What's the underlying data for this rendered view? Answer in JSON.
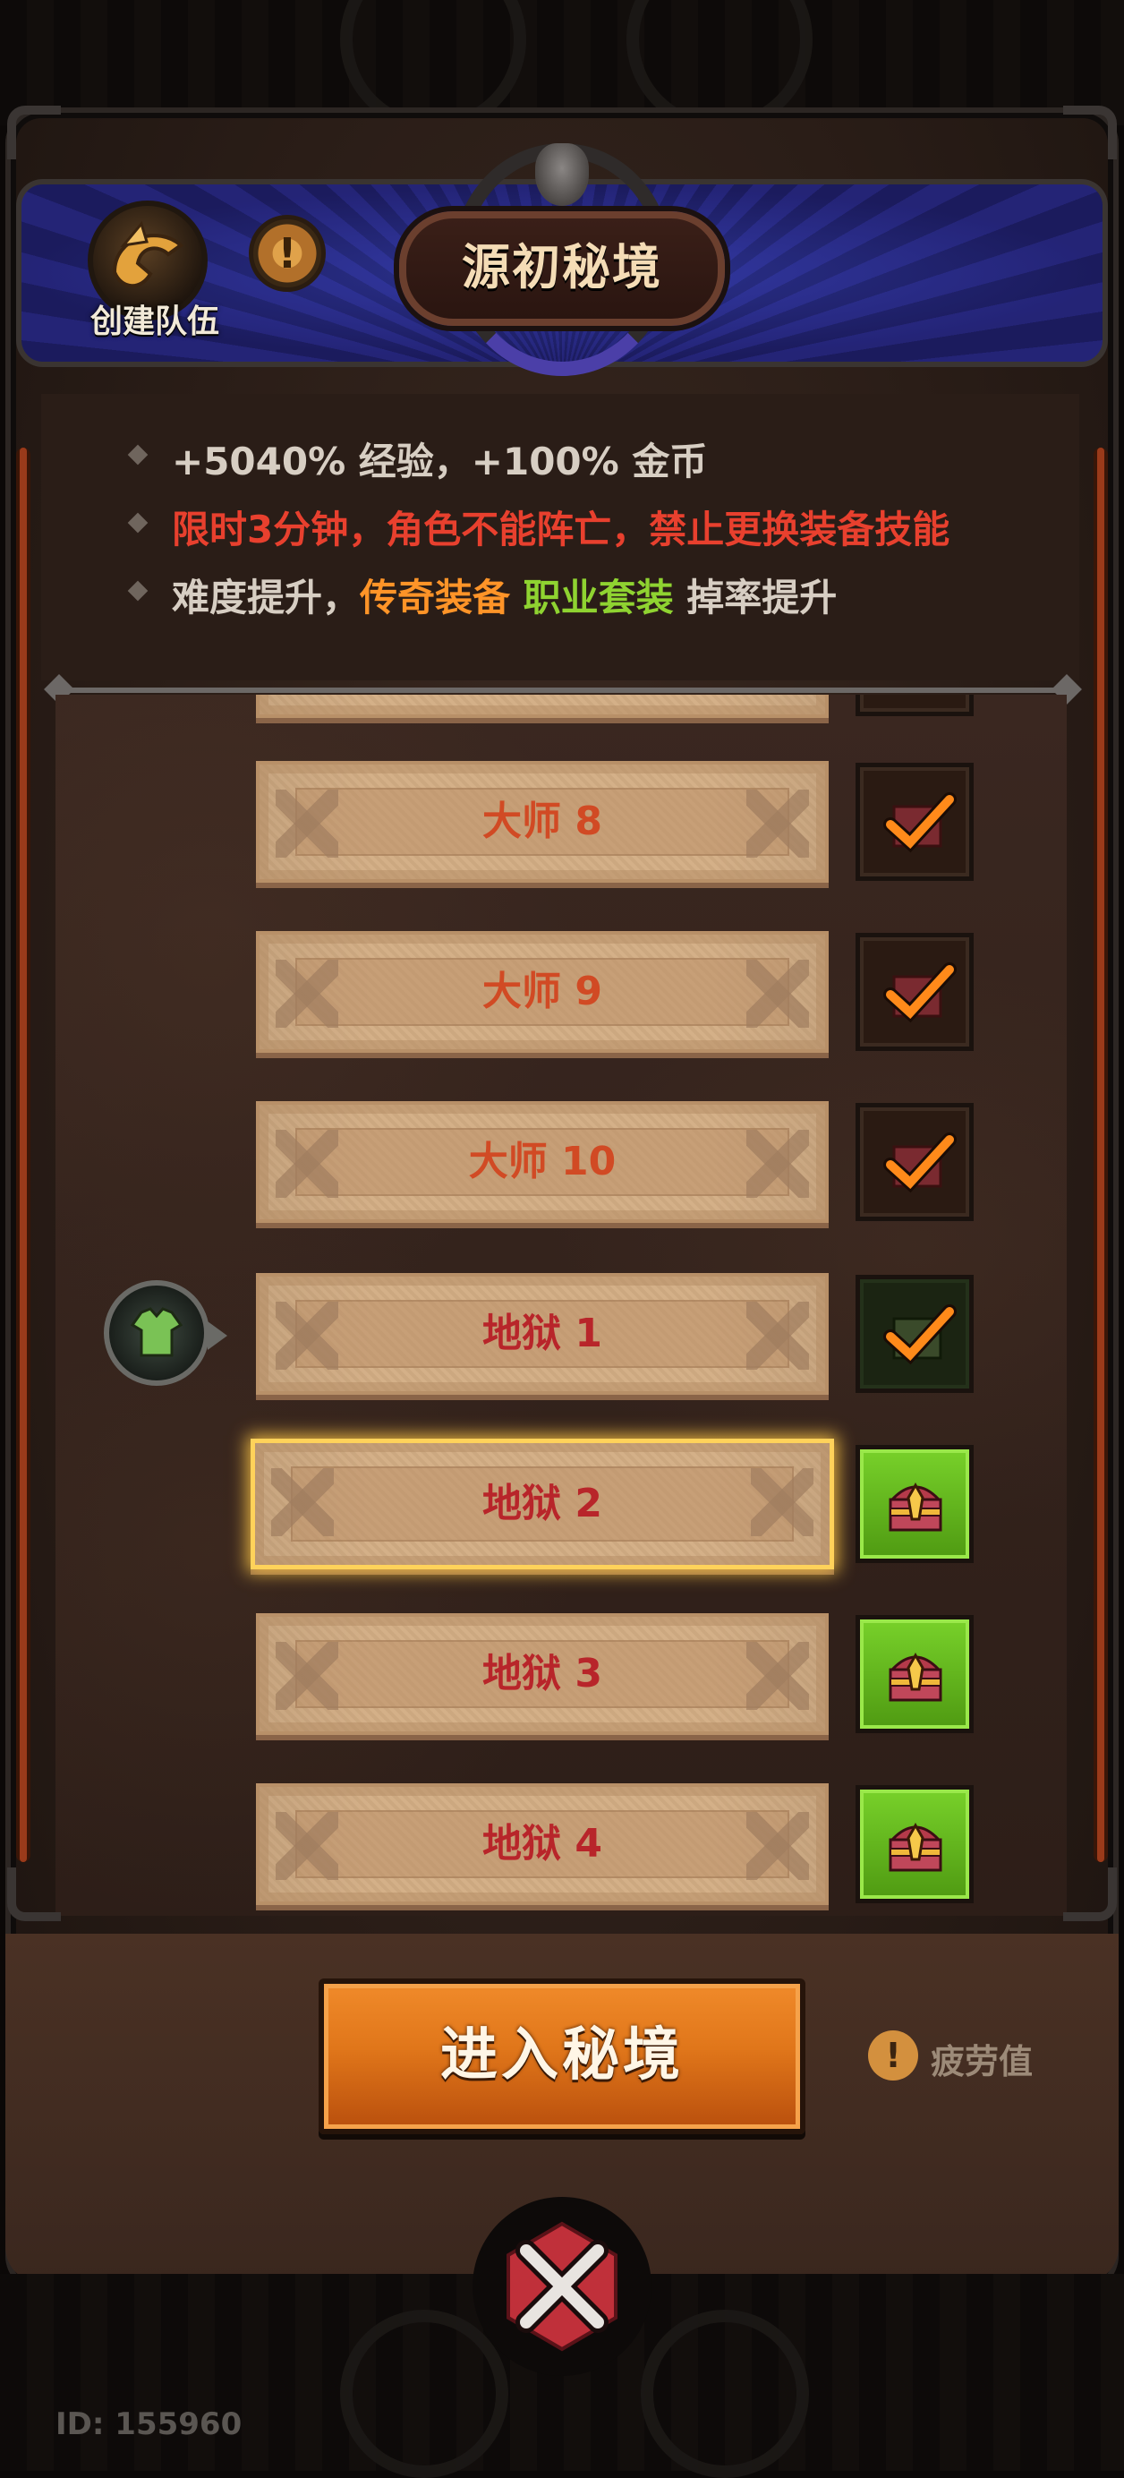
{
  "header": {
    "team_label": "创建队伍",
    "info_symbol": "!",
    "title": "源初秘境"
  },
  "info": {
    "line1": "+5040% 经验，+100% 金币",
    "line2": "限时3分钟，角色不能阵亡，禁止更换装备技能",
    "line3": {
      "prefix": "难度提升，",
      "legendary": "传奇装备",
      "class_set": "职业套装",
      "suffix": "掉率提升"
    }
  },
  "levels": [
    {
      "label": "大师 8",
      "status": "claimed"
    },
    {
      "label": "大师 9",
      "status": "claimed"
    },
    {
      "label": "大师 10",
      "status": "claimed"
    },
    {
      "label": "地狱 1",
      "status": "claimed",
      "current_marker": true
    },
    {
      "label": "地狱 2",
      "status": "available",
      "selected": true
    },
    {
      "label": "地狱 3",
      "status": "available"
    },
    {
      "label": "地狱 4",
      "status": "available"
    }
  ],
  "footer": {
    "enter_label": "进入秘境",
    "fatigue_symbol": "!",
    "fatigue_label": "疲劳值",
    "user_id": "ID: 155960"
  },
  "icons": {
    "team": "helmet-icon",
    "marker": "armor-icon",
    "chest": "treasure-chest-icon",
    "close": "close-x-icon"
  },
  "colors": {
    "header_blue": "#2a2a8a",
    "red_text": "#e8402e",
    "orange_text": "#ff9428",
    "green_text": "#8fd331",
    "enter_button": "#e0761a",
    "chest_available": "#6fc41f"
  }
}
